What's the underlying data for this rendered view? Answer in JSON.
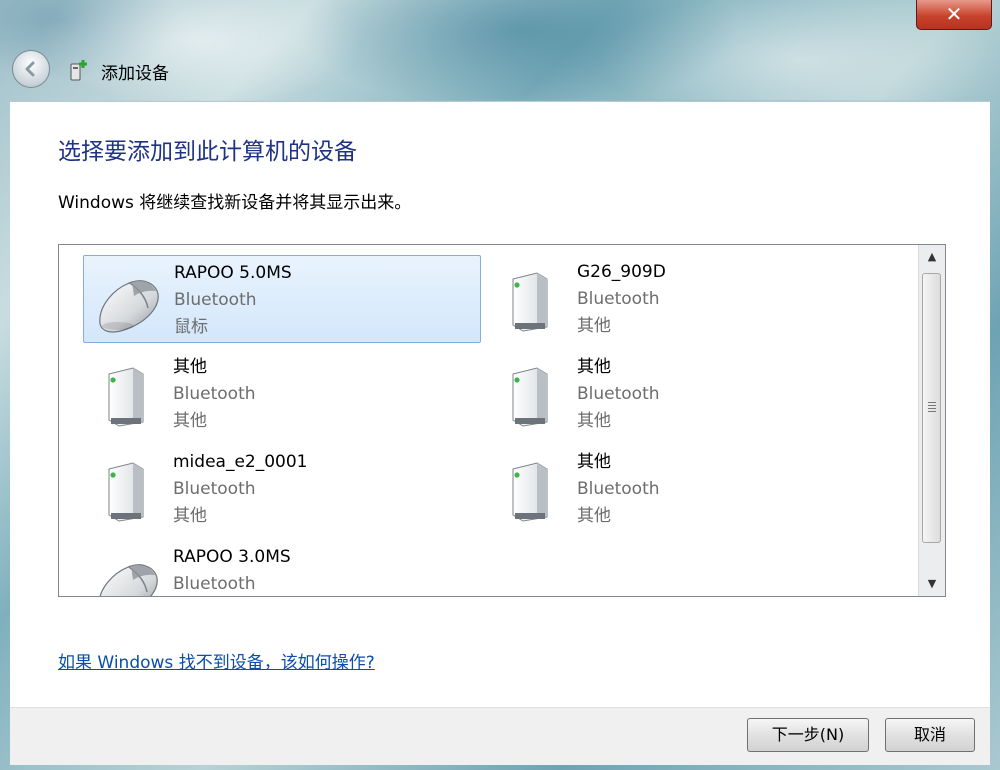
{
  "window": {
    "title": "添加设备",
    "close_label": "✕"
  },
  "main": {
    "heading": "选择要添加到此计算机的设备",
    "instruction": "Windows 将继续查找新设备并将其显示出来。",
    "help_link": "如果 Windows 找不到设备，该如何操作?"
  },
  "devices": [
    {
      "name": "RAPOO 5.0MS",
      "type": "Bluetooth",
      "category": "鼠标",
      "icon": "mouse-icon",
      "selected": true
    },
    {
      "name": "G26_909D",
      "type": "Bluetooth",
      "category": "其他",
      "icon": "generic-device-icon",
      "selected": false
    },
    {
      "name": "其他",
      "type": "Bluetooth",
      "category": "其他",
      "icon": "generic-device-icon",
      "selected": false
    },
    {
      "name": "其他",
      "type": "Bluetooth",
      "category": "其他",
      "icon": "generic-device-icon",
      "selected": false
    },
    {
      "name": "midea_e2_0001",
      "type": "Bluetooth",
      "category": "其他",
      "icon": "generic-device-icon",
      "selected": false
    },
    {
      "name": "其他",
      "type": "Bluetooth",
      "category": "其他",
      "icon": "generic-device-icon",
      "selected": false
    },
    {
      "name": "RAPOO 3.0MS",
      "type": "Bluetooth",
      "category": "",
      "icon": "mouse-icon",
      "selected": false
    }
  ],
  "buttons": {
    "next": "下一步(N)",
    "cancel": "取消"
  },
  "colors": {
    "heading": "#1e3287",
    "link": "#0a4ea8",
    "selection": "#d3e7fb"
  }
}
